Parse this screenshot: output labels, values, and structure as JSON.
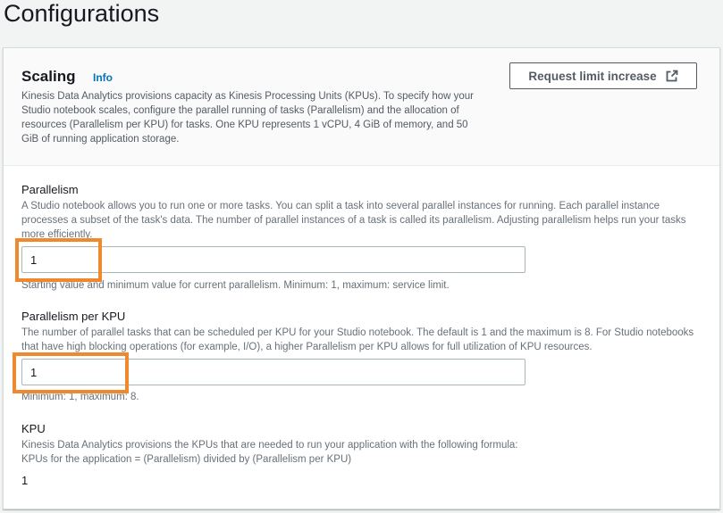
{
  "page": {
    "title": "Configurations"
  },
  "scaling": {
    "title": "Scaling",
    "info_label": "Info",
    "description": "Kinesis Data Analytics provisions capacity as Kinesis Processing Units (KPUs). To specify how your Studio notebook scales, configure the parallel running of tasks (Parallelism) and the allocation of resources (Parallelism per KPU) for tasks. One KPU represents 1 vCPU, 4 GiB of memory, and 50 GiB of running application storage.",
    "limit_button_label": "Request limit increase",
    "limit_button_icon": "external-link-icon"
  },
  "parallelism": {
    "label": "Parallelism",
    "description": "A Studio notebook allows you to run one or more tasks. You can split a task into several parallel instances for running. Each parallel instance processes a subset of the task's data. The number of parallel instances of a task is called its parallelism. Adjusting parallelism helps run your tasks more efficiently.",
    "value": "1",
    "hint": "Starting value and minimum value for current parallelism. Minimum: 1, maximum: service limit."
  },
  "parallelism_per_kpu": {
    "label": "Parallelism per KPU",
    "description": "The number of parallel tasks that can be scheduled per KPU for your Studio notebook. The default is 1 and the maximum is 8. For Studio notebooks that have high blocking operations (for example, I/O), a higher Parallelism per KPU allows for full utilization of KPU resources.",
    "value": "1",
    "hint": "Minimum: 1, maximum: 8."
  },
  "kpu": {
    "label": "KPU",
    "description_line1": "Kinesis Data Analytics provisions the KPUs that are needed to run your application with the following formula:",
    "description_line2": "KPUs for the application = (Parallelism) divided by (Parallelism per KPU)",
    "value": "1"
  },
  "colors": {
    "highlight": "#f0882e",
    "link": "#0073bb"
  }
}
